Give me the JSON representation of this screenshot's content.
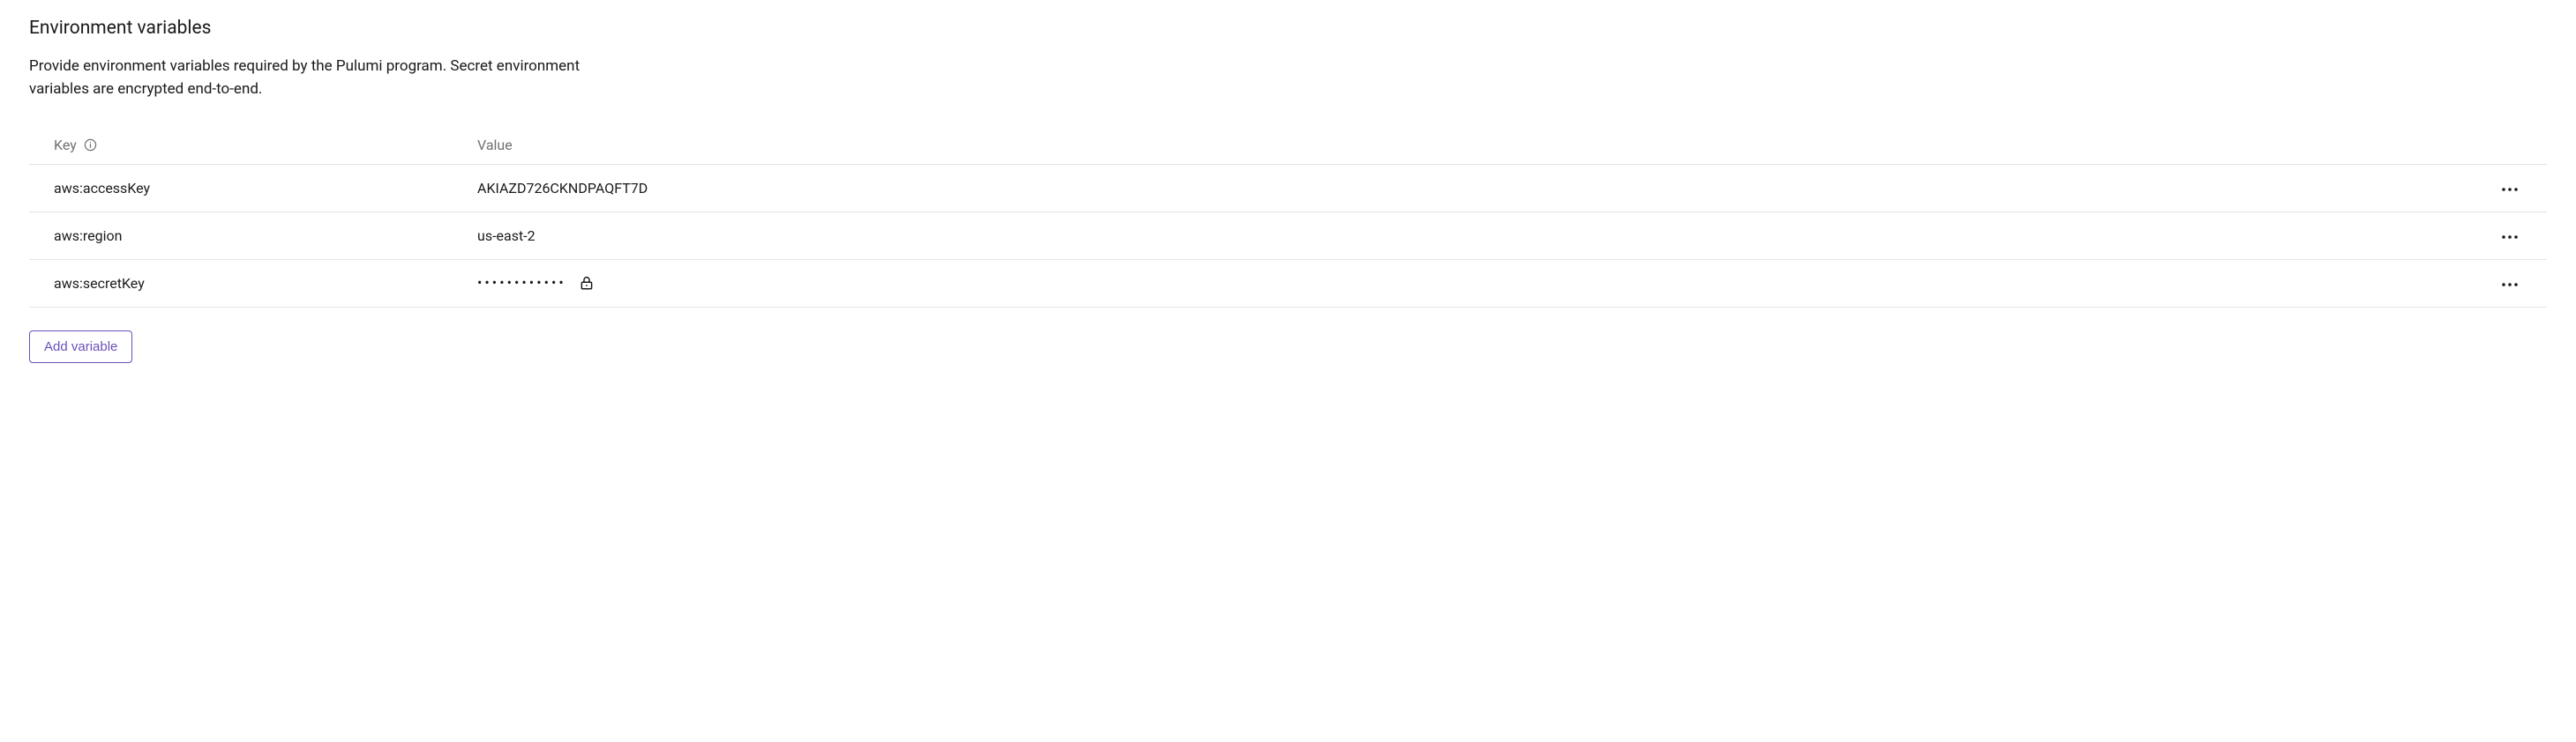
{
  "section": {
    "title": "Environment variables",
    "description": "Provide environment variables required by the Pulumi program. Secret environment variables are encrypted end-to-end."
  },
  "table": {
    "headers": {
      "key": "Key",
      "value": "Value"
    },
    "rows": [
      {
        "key": "aws:accessKey",
        "value": "AKIAZD726CKNDPAQFT7D",
        "secret": false
      },
      {
        "key": "aws:region",
        "value": "us-east-2",
        "secret": false
      },
      {
        "key": "aws:secretKey",
        "value": "••••••••••••",
        "secret": true
      }
    ]
  },
  "buttons": {
    "add": "Add variable"
  }
}
